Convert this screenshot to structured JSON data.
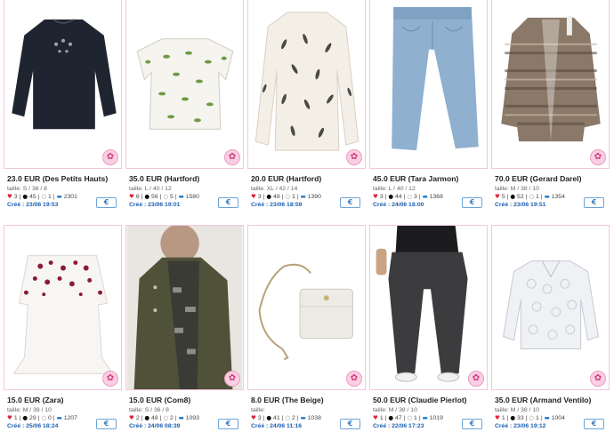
{
  "items": [
    {
      "title": "23.0 EUR (Des Petits Hauts)",
      "size": "taille: S / 36 / 8",
      "hearts": "3",
      "dots": "45",
      "chats": "1",
      "views": "2301",
      "created": "Créé : 23/06 19:53",
      "liked": false
    },
    {
      "title": "35.0 EUR (Hartford)",
      "size": "taille: L / 40 / 12",
      "hearts": "6",
      "dots": "56",
      "chats": "5",
      "views": "1580",
      "created": "Créé : 23/06 19:01",
      "liked": false
    },
    {
      "title": "20.0 EUR (Hartford)",
      "size": "taille: XL / 42 / 14",
      "hearts": "3",
      "dots": "48",
      "chats": "1",
      "views": "1390",
      "created": "Créé : 23/06 18:59",
      "liked": false
    },
    {
      "title": "45.0 EUR (Tara Jarmon)",
      "size": "taille: L / 40 / 12",
      "hearts": "3",
      "dots": "44",
      "chats": "3",
      "views": "1368",
      "created": "Créé : 24/06 18:00",
      "liked": true
    },
    {
      "title": "70.0 EUR (Gerard Darel)",
      "size": "taille: M / 38 / 10",
      "hearts": "5",
      "dots": "52",
      "chats": "1",
      "views": "1354",
      "created": "Créé : 23/06 19:51",
      "liked": false
    },
    {
      "title": "15.0 EUR (Zara)",
      "size": "taille: M / 38 / 10",
      "hearts": "1",
      "dots": "29",
      "chats": "0",
      "views": "1207",
      "created": "Créé : 25/06 18:24",
      "liked": false
    },
    {
      "title": "15.0 EUR (Com8)",
      "size": "taille: S / 36 / 8",
      "hearts": "2",
      "dots": "48",
      "chats": "2",
      "views": "1093",
      "created": "Créé : 24/06 08:39",
      "liked": false
    },
    {
      "title": "8.0 EUR (The Beige)",
      "size": "taille:",
      "hearts": "3",
      "dots": "41",
      "chats": "2",
      "views": "1038",
      "created": "Créé : 24/06 11:16",
      "liked": false
    },
    {
      "title": "50.0 EUR (Claudie Pierlot)",
      "size": "taille: M / 38 / 10",
      "hearts": "1",
      "dots": "47",
      "chats": "1",
      "views": "1019",
      "created": "Créé : 22/06 17:23",
      "liked": false
    },
    {
      "title": "35.0 EUR (Armand Ventilo)",
      "size": "taille: M / 38 / 10",
      "hearts": "1",
      "dots": "33",
      "chats": "1",
      "views": "1004",
      "created": "Créé : 23/06 19:12",
      "liked": false
    }
  ],
  "icons": {
    "favorite": "flower-favorite-icon",
    "liked": "heart-liked-icon",
    "heart": "heart-icon",
    "dot": "bullet-icon",
    "chat": "comment-icon",
    "views": "monitor-icon",
    "action": "euro-icon"
  },
  "glyphs": {
    "heart": "♥",
    "dot": "●",
    "chat": "○",
    "mon": "▬",
    "flower": "✿",
    "action": "€"
  },
  "colors": {
    "card_border": "#f3c6dc",
    "accent_blue": "#1b5fb1",
    "heart_red": "#d8263a",
    "fav_pink": "#f9cfe3"
  }
}
